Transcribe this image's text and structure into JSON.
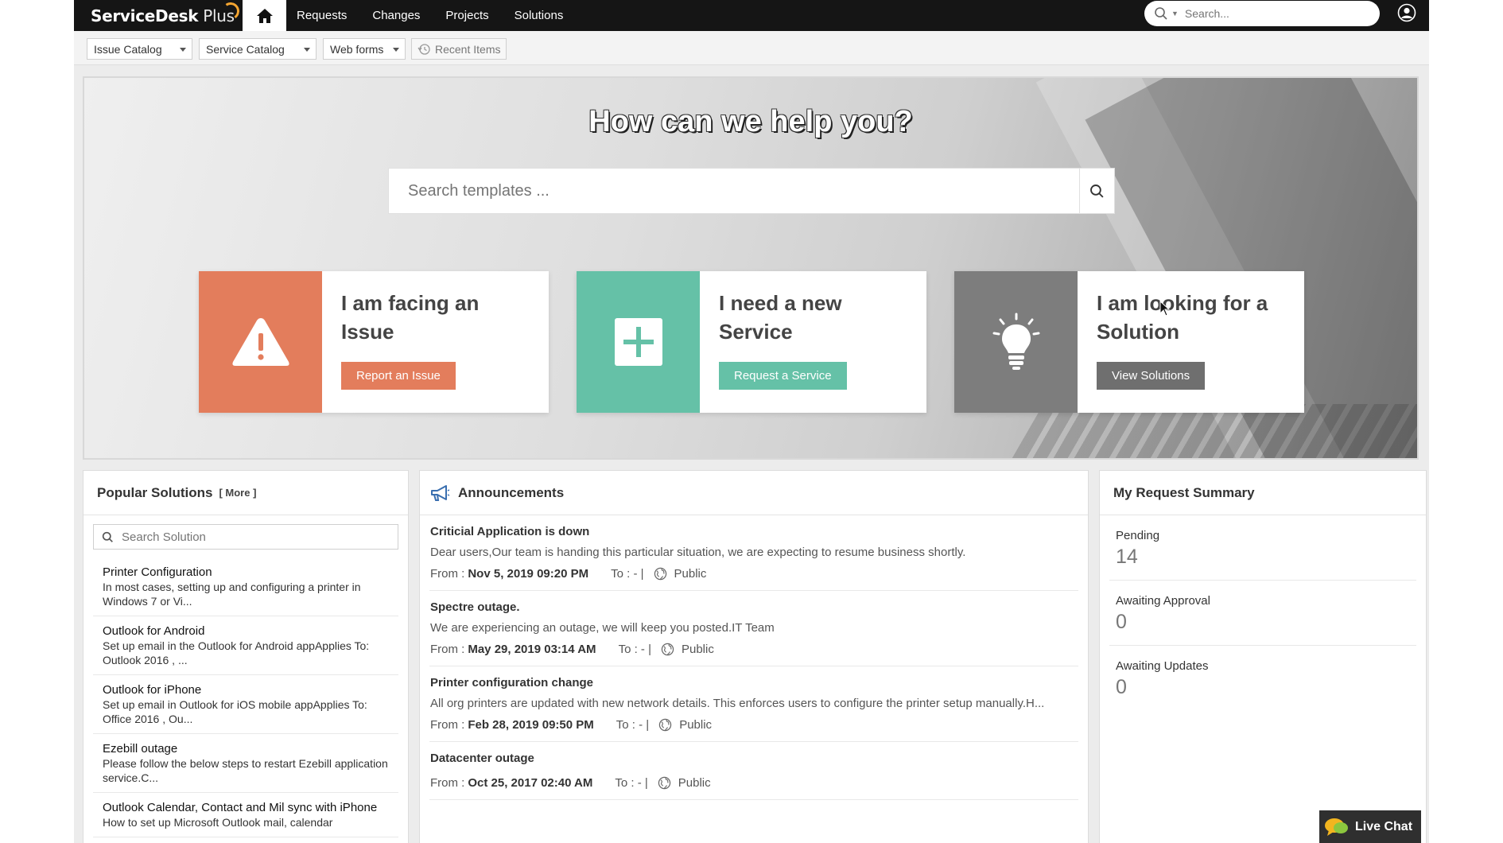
{
  "app": {
    "logo_main": "ServiceDesk",
    "logo_plus": " Plus"
  },
  "nav": {
    "items": [
      "Requests",
      "Changes",
      "Projects",
      "Solutions"
    ],
    "search_placeholder": "Search..."
  },
  "toolbar": {
    "dropdowns": [
      "Issue Catalog",
      "Service Catalog",
      "Web forms"
    ],
    "recent_items": "Recent Items"
  },
  "hero": {
    "title": "How can we help you?",
    "search_placeholder": "Search templates ..."
  },
  "cards": [
    {
      "title_line1": "I am facing an",
      "title_line2": "Issue",
      "button": "Report an Issue",
      "color": "#e37d5c",
      "icon": "warning-icon"
    },
    {
      "title_line1": "I need a new",
      "title_line2": "Service",
      "button": "Request a Service",
      "color": "#65c1a7",
      "icon": "plus-icon"
    },
    {
      "title_line1": "I am looking for a",
      "title_line2": "Solution",
      "button": "View Solutions",
      "color": "#7d7d7d",
      "icon": "lightbulb-icon"
    }
  ],
  "popular_solutions": {
    "title": "Popular Solutions",
    "more": "[ More ]",
    "search_placeholder": "Search Solution",
    "items": [
      {
        "title": "Printer Configuration",
        "desc": "In most cases, setting up and configuring a printer in Windows 7 or Vi..."
      },
      {
        "title": "Outlook for Android",
        "desc": "Set up email in the Outlook for Android appApplies To: Outlook 2016 , ..."
      },
      {
        "title": "Outlook for iPhone",
        "desc": "Set up email in Outlook for iOS mobile appApplies To: Office 2016 , Ou..."
      },
      {
        "title": "Ezebill outage",
        "desc": "Please follow the below steps to restart Ezebill application service.C..."
      },
      {
        "title": "Outlook Calendar, Contact and Mil sync with iPhone",
        "desc": "How to set up Microsoft Outlook mail, calendar"
      }
    ]
  },
  "announcements": {
    "title": "Announcements",
    "from_label": "From :",
    "to_label": "To : - |",
    "items": [
      {
        "title": "Criticial Application is down",
        "desc": "Dear users,Our team is handing this particular situation, we are expecting to resume business shortly.",
        "from": "Nov 5, 2019 09:20 PM",
        "visibility": "Public"
      },
      {
        "title": "Spectre outage.",
        "desc": "We are experiencing an outage, we will keep you posted.IT Team",
        "from": "May 29, 2019 03:14 AM",
        "visibility": "Public"
      },
      {
        "title": "Printer configuration change",
        "desc": "All org printers are updated with new network details. This enforces users to configure the printer setup manually.H...",
        "from": "Feb 28, 2019 09:50 PM",
        "visibility": "Public"
      },
      {
        "title": "Datacenter outage",
        "desc": "",
        "from": "Oct 25, 2017 02:40 AM",
        "visibility": "Public"
      }
    ]
  },
  "summary": {
    "title": "My Request Summary",
    "items": [
      {
        "label": "Pending",
        "value": "14"
      },
      {
        "label": "Awaiting Approval",
        "value": "0"
      },
      {
        "label": "Awaiting Updates",
        "value": "0"
      }
    ]
  },
  "live_chat": "Live Chat"
}
